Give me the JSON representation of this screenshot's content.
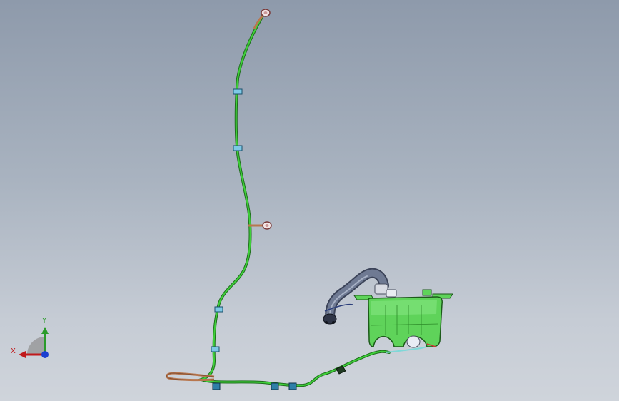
{
  "viewport": {
    "background_top": "#8e9aab",
    "background_bottom": "#cfd4db"
  },
  "colors": {
    "hose": "#3fcf3a",
    "hose_outline": "#1e6e1c",
    "tank_fill": "#5fd35a",
    "tank_outline": "#1c5a1a",
    "filler_neck": "#6f7a93",
    "copper_tube": "#b8774f",
    "clip": "#2f7fa8",
    "axis_x": "#c0191b",
    "axis_y": "#2a9b2a",
    "axis_z": "#1b3fd0"
  },
  "axes": {
    "x_label": "X",
    "y_label": "Y"
  },
  "icons": {
    "triad": "coordinate-triad-icon"
  }
}
